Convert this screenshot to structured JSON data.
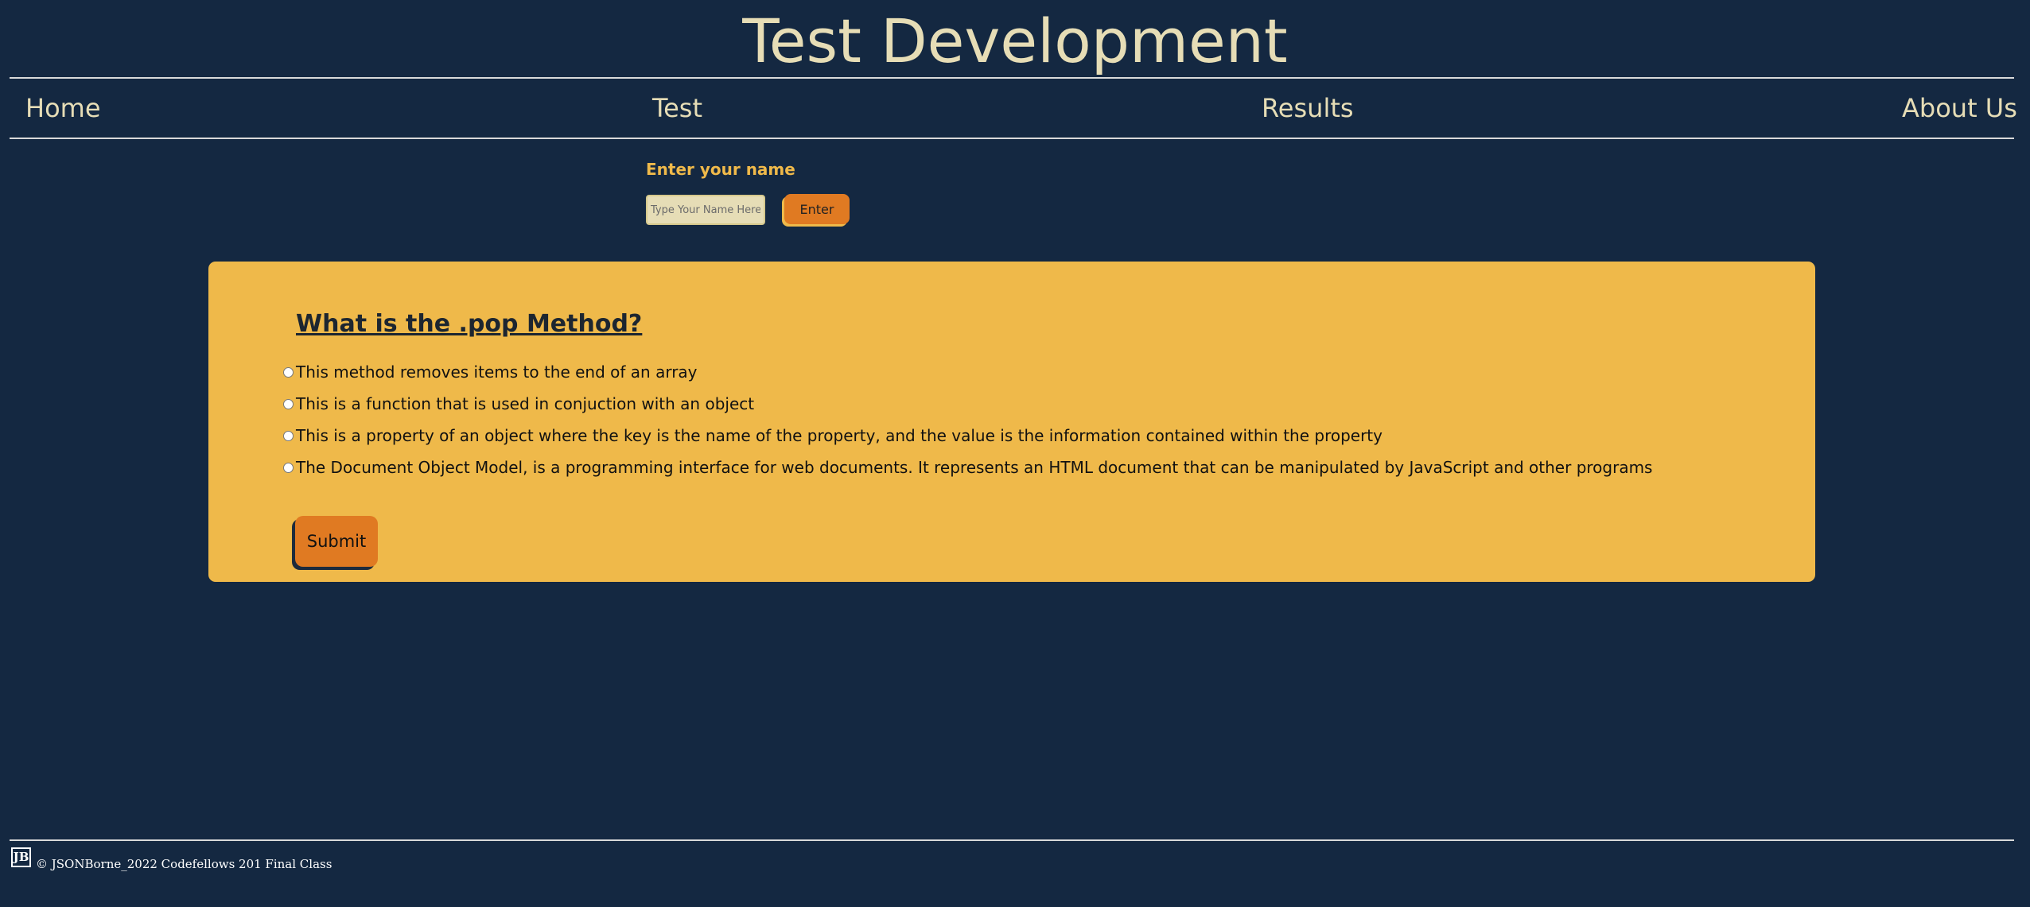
{
  "header": {
    "title": "Test Development"
  },
  "nav": {
    "items": [
      "Home",
      "Test",
      "Results",
      "About Us"
    ]
  },
  "name_form": {
    "label": "Enter your name",
    "placeholder": "Type Your Name Here",
    "value": "",
    "button_label": "Enter"
  },
  "quiz": {
    "question": "What is the .pop Method?",
    "answers": [
      "This method removes items to the end of an array",
      "This is a function that is used in conjuction with an object",
      "This is a property of an object where the key is the name of the property, and the value is the information contained within the property",
      "The Document Object Model, is a programming interface for web documents. It represents an HTML document that can be manipulated by JavaScript and other programs"
    ],
    "selected_index": null,
    "submit_label": "Submit"
  },
  "footer": {
    "logo_text": "JB",
    "text": "© JSONBorne_2022 Codefellows 201 Final Class"
  },
  "colors": {
    "background": "#142841",
    "title_text": "#e6ddb6",
    "accent_yellow": "#efb94a",
    "button_orange": "#e07a22"
  },
  "icons": {
    "footer_logo": "jb-logo-icon"
  }
}
